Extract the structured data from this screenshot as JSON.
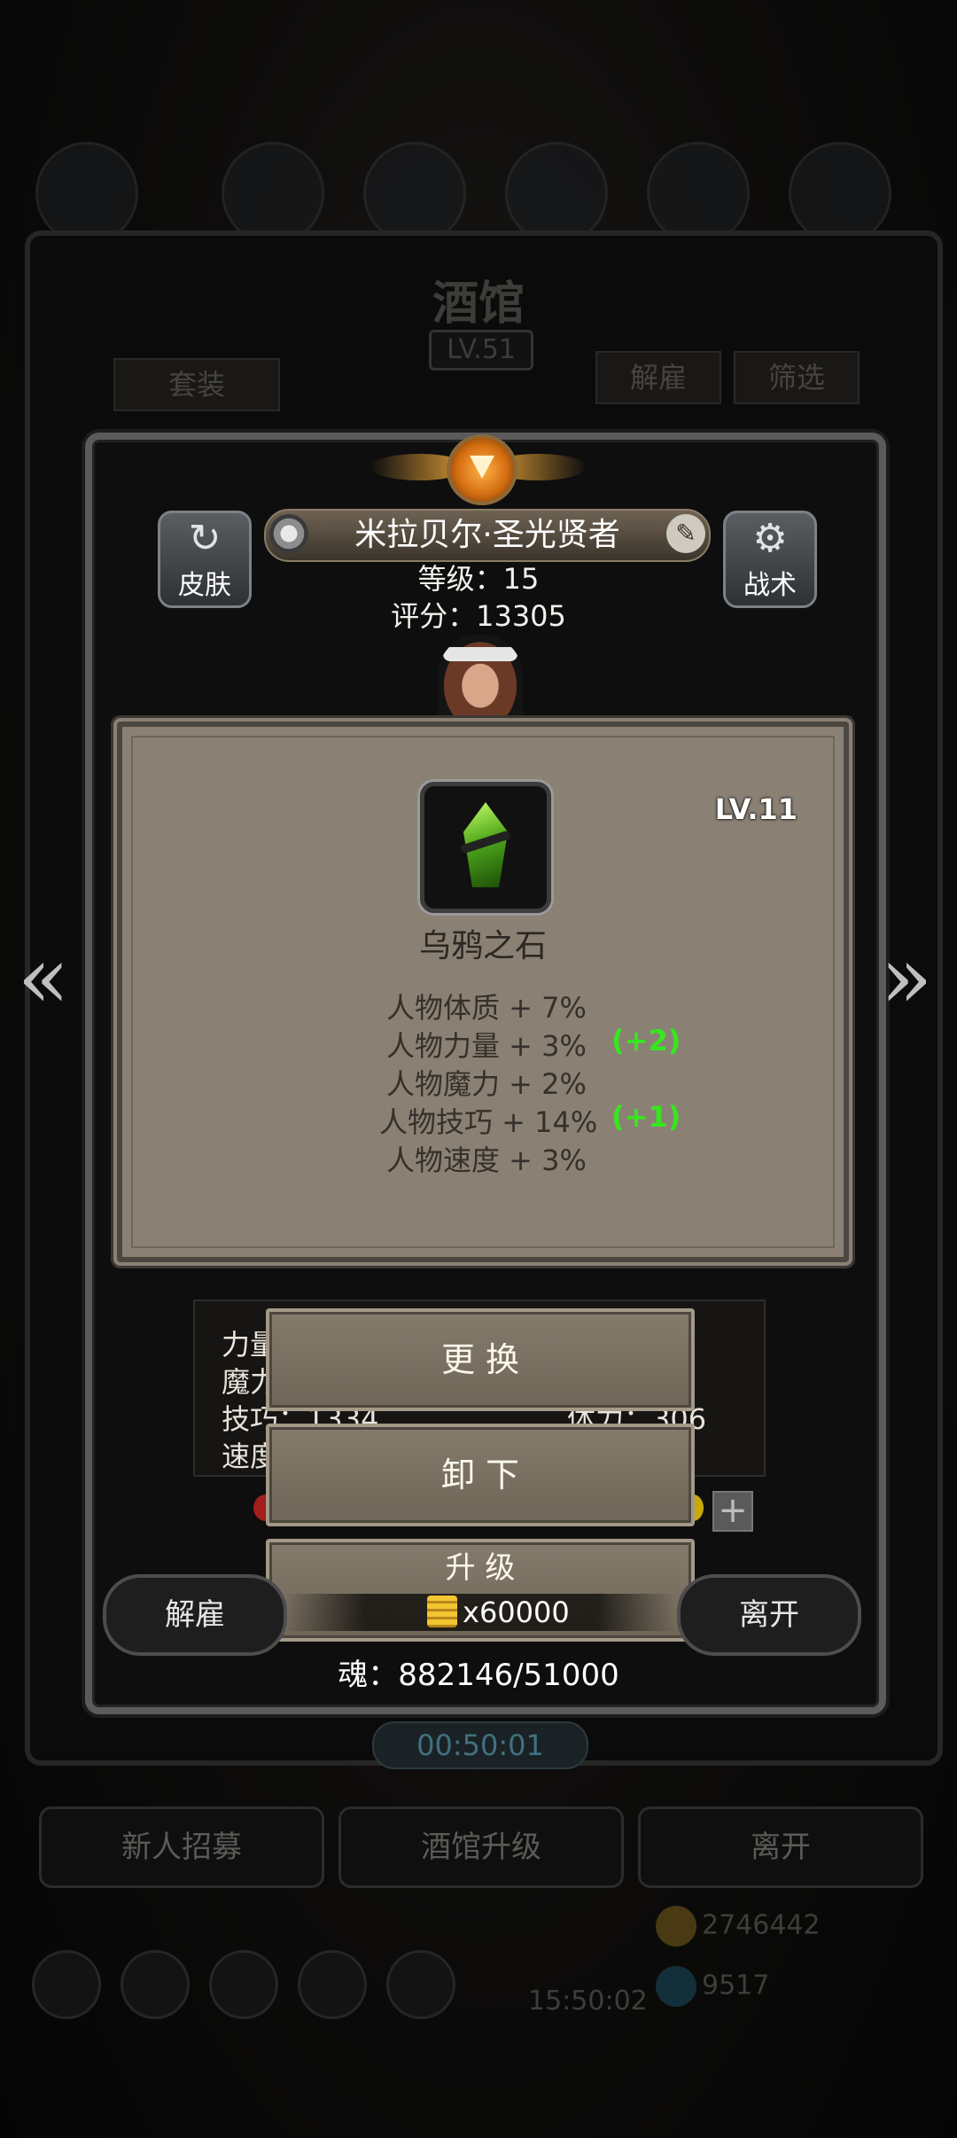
{
  "background": {
    "title": "酒馆",
    "level": "LV.51",
    "tab_suit": "套装",
    "tab_dismiss": "解雇",
    "tab_filter": "筛选",
    "timer": "00:50:01",
    "bottom_buttons": [
      "新人招募",
      "酒馆升级",
      "离开"
    ],
    "gold": "2746442",
    "gems": "9517",
    "gift_timer": "15:50:02"
  },
  "hero": {
    "name": "米拉贝尔·圣光贤者",
    "level_label": "等级：15",
    "score_label": "评分：13305",
    "skin_button": "皮肤",
    "tactics_button": "战术"
  },
  "stats_panel": {
    "rows": [
      "力量",
      "魔力",
      "技巧：1334",
      "速度"
    ],
    "extra": "体力：306"
  },
  "item": {
    "level": "LV.11",
    "name": "乌鸦之石",
    "attributes": [
      {
        "text": "人物体质 + 7%",
        "bonus": ""
      },
      {
        "text": "人物力量 + 3%",
        "bonus": "(+2)"
      },
      {
        "text": "人物魔力 + 2%",
        "bonus": ""
      },
      {
        "text": "人物技巧 + 14%",
        "bonus": "(+1)"
      },
      {
        "text": "人物速度 + 3%",
        "bonus": ""
      }
    ],
    "bonus_color": "#37e61f"
  },
  "actions": {
    "replace": "更 换",
    "unequip": "卸 下",
    "upgrade": "升 级",
    "upgrade_cost": "x60000",
    "dismiss": "解雇",
    "leave": "离开"
  },
  "soul_label": "魂：882146/51000",
  "icons": {
    "skin": "shirt-refresh-icon",
    "tactics": "gear-icon",
    "medal": "medal-icon",
    "edit": "edit-icon",
    "prev": "chevron-left-icon",
    "next": "chevron-right-icon",
    "coin": "gold-coin-icon"
  }
}
